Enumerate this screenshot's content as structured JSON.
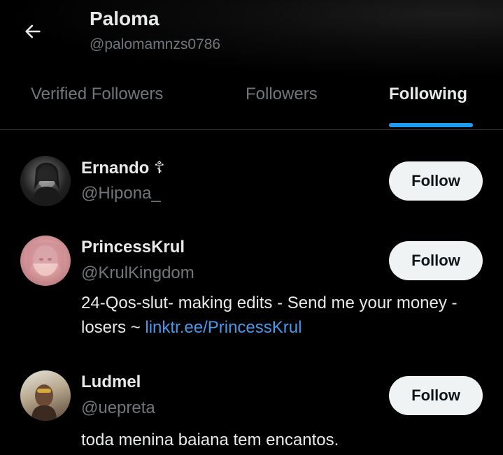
{
  "header": {
    "title": "Paloma",
    "handle": "@palomamnzs0786",
    "back_icon": "arrow-left-icon"
  },
  "tabs": [
    {
      "label": "Verified Followers",
      "active": false
    },
    {
      "label": "Followers",
      "active": false
    },
    {
      "label": "Following",
      "active": true
    }
  ],
  "colors": {
    "background": "#000000",
    "primary_text": "#e7e9ea",
    "secondary_text": "#71767b",
    "accent": "#1d9bf0",
    "link": "#4a99e9",
    "button_bg": "#eff3f4"
  },
  "users": [
    {
      "name": "Ernando ☦",
      "handle": "@Hipona_",
      "bio_text": "",
      "bio_link": "",
      "follow_label": "Follow"
    },
    {
      "name": "PrincessKrul",
      "handle": "@KrulKingdom",
      "bio_text": "24-Qos-slut- making edits - Send me your money - losers ~ ",
      "bio_link": "linktr.ee/PrincessKrul",
      "follow_label": "Follow"
    },
    {
      "name": "Ludmel",
      "handle": "@uepreta",
      "bio_text": "toda menina baiana tem encantos.",
      "bio_link": "",
      "follow_label": "Follow"
    }
  ]
}
